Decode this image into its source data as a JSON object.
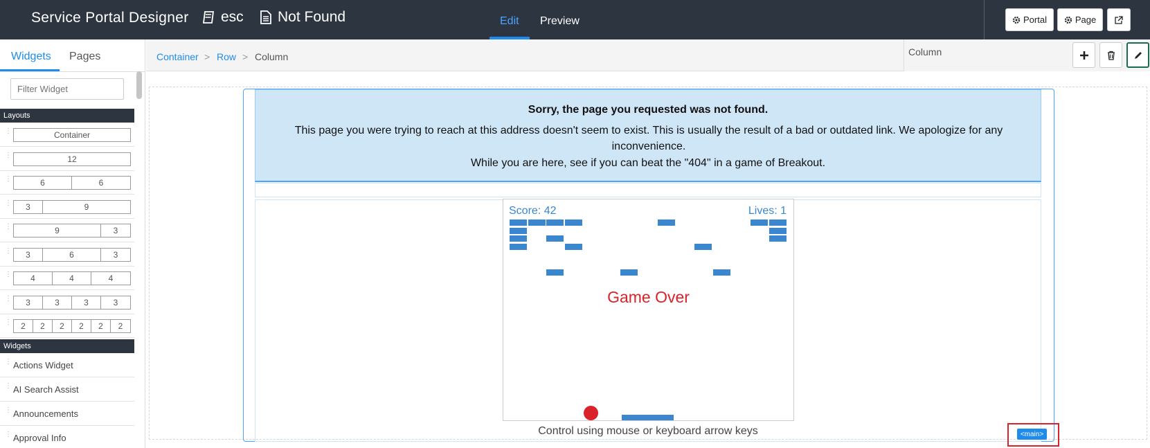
{
  "header": {
    "app_title": "Service Portal Designer",
    "portal_name": "esc",
    "page_name": "Not Found",
    "modes": {
      "edit": "Edit",
      "preview": "Preview"
    },
    "buttons": {
      "portal": "Portal",
      "page": "Page"
    }
  },
  "left_panel": {
    "tabs": {
      "widgets": "Widgets",
      "pages": "Pages"
    },
    "filter_placeholder": "Filter Widget",
    "layouts_heading": "Layouts",
    "layouts": [
      [
        "Container"
      ],
      [
        "12"
      ],
      [
        "6",
        "6"
      ],
      [
        "3",
        "9"
      ],
      [
        "9",
        "3"
      ],
      [
        "3",
        "6",
        "3"
      ],
      [
        "4",
        "4",
        "4"
      ],
      [
        "3",
        "3",
        "3",
        "3"
      ],
      [
        "2",
        "2",
        "2",
        "2",
        "2",
        "2"
      ]
    ],
    "widgets_heading": "Widgets",
    "widgets": [
      "Actions Widget",
      "AI Search Assist",
      "Announcements",
      "Approval Info"
    ]
  },
  "breadcrumb": {
    "container": "Container",
    "row": "Row",
    "column": "Column",
    "separator": ">"
  },
  "properties_panel": {
    "label": "Column"
  },
  "alert": {
    "heading": "Sorry, the page you requested was not found.",
    "body": "This page you were trying to reach at this address doesn't seem to exist. This is usually the result of a bad or outdated link. We apologize for any inconvenience.",
    "invite": "While you are here, see if you can beat the \"404\" in a game of Breakout."
  },
  "game": {
    "score_text": "Score: 42",
    "lives_text": "Lives: 1",
    "status": "Game Over",
    "controls": "Control using mouse or keyboard arrow keys",
    "colors": {
      "bricks": "#3a87d0",
      "ball": "#d9222a",
      "game_over": "#d9222a"
    }
  },
  "main_tag": "<main>",
  "colors": {
    "topbar": "#2d3540",
    "accent": "#1f8ceb",
    "alert_bg": "#cfe6f7"
  }
}
